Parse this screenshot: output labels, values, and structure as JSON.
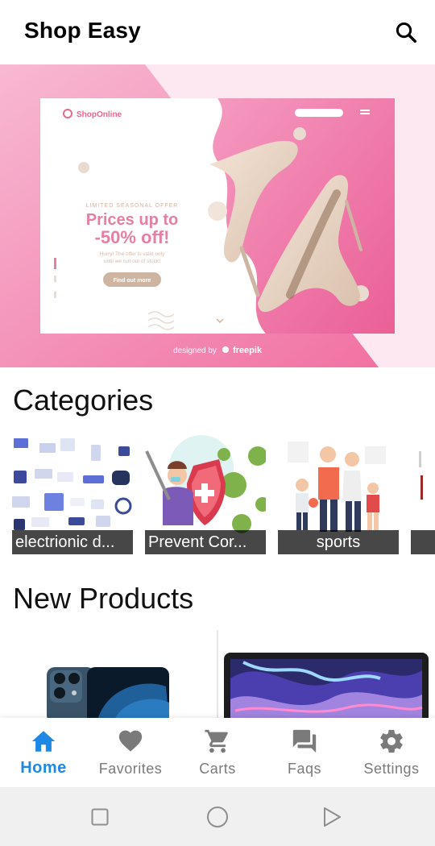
{
  "app": {
    "title": "Shop Easy"
  },
  "banner": {
    "brand": "ShopOnline",
    "kicker": "LIMITED SEASONAL OFFER",
    "headline_line1": "Prices up to",
    "headline_line2": "-50% off!",
    "subtext_line1": "Hurry! The offer is valid only",
    "subtext_line2": "until we run out of stock!",
    "cta": "Find out more",
    "credit": "designed by",
    "credit_brand": "freepik"
  },
  "sections": {
    "categories": "Categories",
    "new_products": "New Products"
  },
  "categories": [
    {
      "label": "electrionic d...",
      "icon": "electronics-devices-image"
    },
    {
      "label": "Prevent Cor...",
      "icon": "prevent-corona-image"
    },
    {
      "label": "sports",
      "icon": "sports-family-image"
    }
  ],
  "products": [
    {
      "image": "iphone-product-image"
    },
    {
      "image": "macbook-product-image"
    }
  ],
  "bottom_nav": [
    {
      "label": "Home",
      "icon": "home-icon",
      "active": true
    },
    {
      "label": "Favorites",
      "icon": "heart-icon",
      "active": false
    },
    {
      "label": "Carts",
      "icon": "cart-icon",
      "active": false
    },
    {
      "label": "Faqs",
      "icon": "chat-icon",
      "active": false
    },
    {
      "label": "Settings",
      "icon": "gear-icon",
      "active": false
    }
  ],
  "colors": {
    "accent": "#1e88e5",
    "nav_inactive": "#7a7a7a",
    "banner_pink": "#f06da0"
  }
}
